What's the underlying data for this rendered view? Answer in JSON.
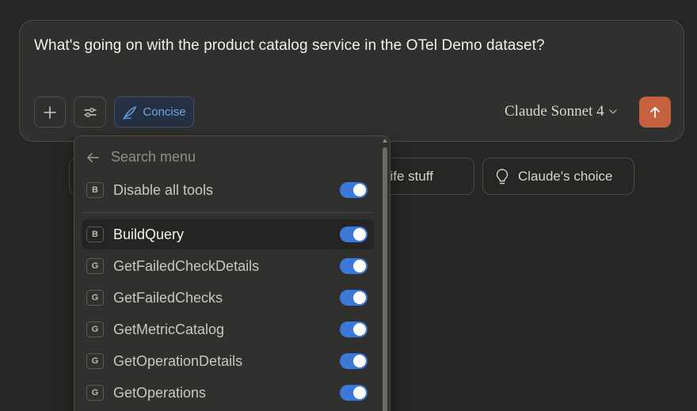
{
  "composer": {
    "prompt": "What's going on with the product catalog service in the OTel Demo dataset?",
    "concise_label": "Concise",
    "model_label": "Claude Sonnet 4",
    "accent_color": "#c6613f"
  },
  "suggestions": [
    {
      "label": ""
    },
    {
      "label": "Life stuff",
      "icon": "pen-icon"
    },
    {
      "label": "Claude's choice",
      "icon": "lightbulb-icon"
    }
  ],
  "menu": {
    "search_placeholder": "Search menu",
    "disable_all": {
      "badge": "B",
      "label": "Disable all tools",
      "enabled": true
    },
    "tools": [
      {
        "badge": "B",
        "label": "BuildQuery",
        "enabled": true,
        "active": true
      },
      {
        "badge": "G",
        "label": "GetFailedCheckDetails",
        "enabled": true
      },
      {
        "badge": "G",
        "label": "GetFailedChecks",
        "enabled": true
      },
      {
        "badge": "G",
        "label": "GetMetricCatalog",
        "enabled": true
      },
      {
        "badge": "G",
        "label": "GetOperationDetails",
        "enabled": true
      },
      {
        "badge": "G",
        "label": "GetOperations",
        "enabled": true
      }
    ],
    "toggle_color": "#3b78d8"
  }
}
